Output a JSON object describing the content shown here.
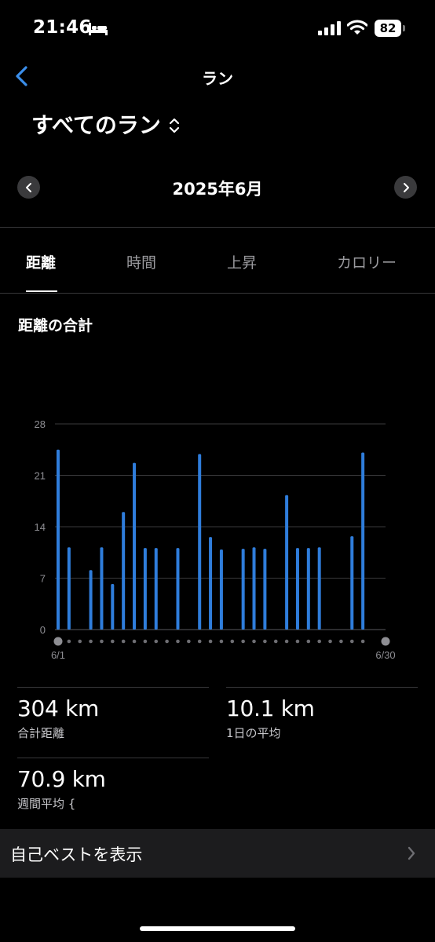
{
  "status_bar": {
    "time": "21:46",
    "battery": "82"
  },
  "nav": {
    "title": "ラン"
  },
  "filter": {
    "label": "すべてのラン"
  },
  "period": {
    "label": "2025年6月"
  },
  "tabs": [
    {
      "label": "距離",
      "active": true
    },
    {
      "label": "時間",
      "active": false
    },
    {
      "label": "上昇",
      "active": false
    },
    {
      "label": "カロリー",
      "active": false
    }
  ],
  "section_title": "距離の合計",
  "chart_data": {
    "type": "bar",
    "categories": [
      "1",
      "2",
      "3",
      "4",
      "5",
      "6",
      "7",
      "8",
      "9",
      "10",
      "11",
      "12",
      "13",
      "14",
      "15",
      "16",
      "17",
      "18",
      "19",
      "20",
      "21",
      "22",
      "23",
      "24",
      "25",
      "26",
      "27",
      "28",
      "29",
      "30"
    ],
    "values": [
      24.5,
      11.2,
      0,
      8.1,
      11.2,
      6.2,
      16.0,
      22.7,
      11.1,
      11.1,
      0,
      11.1,
      0,
      23.9,
      12.6,
      10.9,
      0,
      11.0,
      11.2,
      11.0,
      0,
      18.3,
      11.1,
      11.1,
      11.2,
      0,
      0,
      12.7,
      24.1,
      0
    ],
    "yticks": [
      0,
      7,
      14,
      21,
      28
    ],
    "ylim": [
      0,
      28
    ],
    "x_start_label": "6/1",
    "x_end_label": "6/30",
    "bar_color": "#2f7ddb",
    "grid": true
  },
  "stats": {
    "total": {
      "value": "304 km",
      "label": "合計距離"
    },
    "daily_avg": {
      "value": "10.1 km",
      "label": "1日の平均"
    },
    "weekly_avg": {
      "value": "70.9 km",
      "label": "週間平均 {"
    }
  },
  "best": {
    "label": "自己ベストを表示"
  },
  "colors": {
    "accent": "#3b8eea",
    "bar": "#2f7ddb",
    "background": "#000000",
    "row": "#1c1c1e"
  }
}
